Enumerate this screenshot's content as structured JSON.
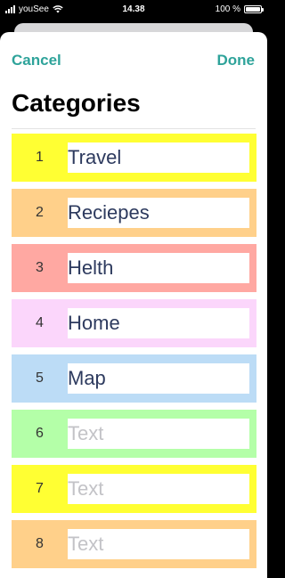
{
  "status": {
    "carrier": "youSee",
    "time": "14.38",
    "battery": "100 %",
    "battery_level": 1.0
  },
  "nav": {
    "cancel_label": "Cancel",
    "done_label": "Done"
  },
  "page_title": "Categories",
  "accent_color": "#2ea39a",
  "rows": [
    {
      "num": "1",
      "value": "Travel",
      "placeholder": "Text",
      "color": "#ffff33"
    },
    {
      "num": "2",
      "value": "Reciepes",
      "placeholder": "Text",
      "color": "#ffd08a"
    },
    {
      "num": "3",
      "value": "Helth",
      "placeholder": "Text",
      "color": "#ffa8a2"
    },
    {
      "num": "4",
      "value": "Home",
      "placeholder": "Text",
      "color": "#fbd6fb"
    },
    {
      "num": "5",
      "value": "Map",
      "placeholder": "Text",
      "color": "#bcdcf6"
    },
    {
      "num": "6",
      "value": "",
      "placeholder": "Text",
      "color": "#b4ffa8"
    },
    {
      "num": "7",
      "value": "",
      "placeholder": "Text",
      "color": "#ffff33"
    },
    {
      "num": "8",
      "value": "",
      "placeholder": "Text",
      "color": "#ffd08a"
    }
  ]
}
